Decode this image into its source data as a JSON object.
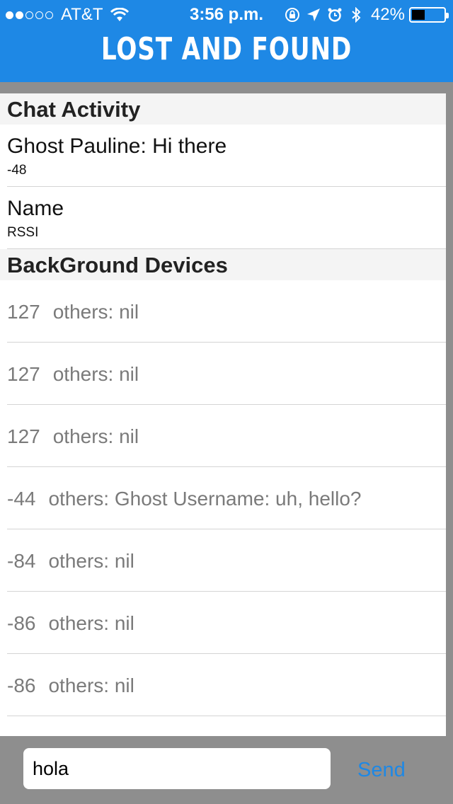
{
  "status_bar": {
    "carrier": "AT&T",
    "time": "3:56 p.m.",
    "battery_percent": "42%",
    "battery_level": 0.42,
    "signal_strength": 2,
    "signal_max": 5,
    "icons": [
      "orientation-lock-icon",
      "location-arrow-icon",
      "alarm-icon",
      "bluetooth-icon"
    ]
  },
  "nav": {
    "title": "LOST AND FOUND"
  },
  "sections": {
    "chat": {
      "header": "Chat Activity",
      "items": [
        {
          "title": "Ghost Pauline: Hi there",
          "subtitle": "-48"
        },
        {
          "title": "Name",
          "subtitle": "RSSI"
        }
      ]
    },
    "background": {
      "header": "BackGround Devices",
      "items": [
        {
          "rssi": "127",
          "text": "others: nil"
        },
        {
          "rssi": "127",
          "text": "others: nil"
        },
        {
          "rssi": "127",
          "text": "others: nil"
        },
        {
          "rssi": "-44",
          "text": "others: Ghost Username: uh, hello?"
        },
        {
          "rssi": "-84",
          "text": "others: nil"
        },
        {
          "rssi": "-86",
          "text": "others: nil"
        },
        {
          "rssi": "-86",
          "text": "others: nil"
        }
      ]
    }
  },
  "composer": {
    "input_value": "hola",
    "send_label": "Send"
  },
  "colors": {
    "accent": "#1e88e5",
    "toolbar": "#8e8e8e"
  }
}
